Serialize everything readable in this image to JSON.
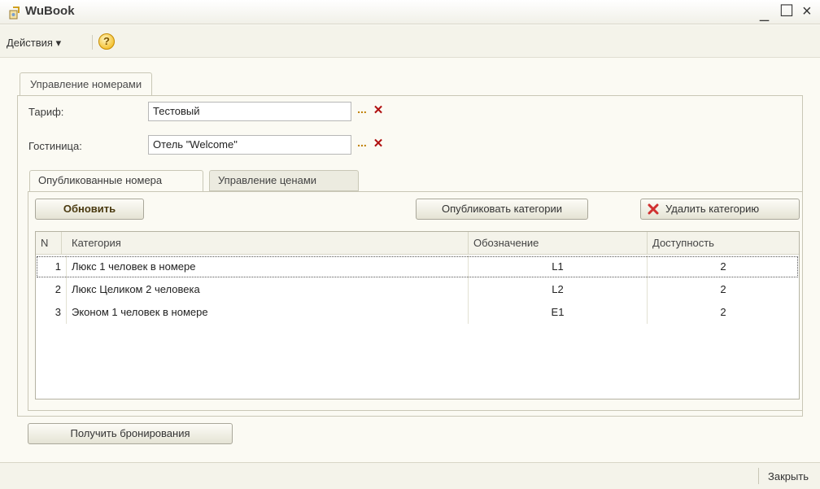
{
  "window": {
    "title": "WuBook"
  },
  "toolbar": {
    "actions_label": "Действия",
    "actions_arrow": "▾",
    "help_symbol": "?"
  },
  "main_tab": {
    "label": "Управление номерами"
  },
  "form": {
    "tariff": {
      "label": "Тариф:",
      "value": "Тестовый"
    },
    "hotel": {
      "label": "Гостиница:",
      "value": "Отель \"Welcome\""
    },
    "pick_symbol": "...",
    "clear_symbol": "✕"
  },
  "subtabs": [
    {
      "label": "Опубликованные номера",
      "active": true
    },
    {
      "label": "Управление ценами",
      "active": false
    }
  ],
  "buttons": {
    "refresh": "Обновить",
    "publish": "Опубликовать категории",
    "delete": "Удалить категорию",
    "get_bookings": "Получить бронирования"
  },
  "table": {
    "columns": [
      "N",
      "Категория",
      "Обозначение",
      "Доступность"
    ],
    "rows": [
      {
        "n": "1",
        "category": "Люкс 1 человек в номере",
        "code": "L1",
        "availability": "2"
      },
      {
        "n": "2",
        "category": "Люкс Целиком 2 человека",
        "code": "L2",
        "availability": "2"
      },
      {
        "n": "3",
        "category": "Эконом 1 человек в номере",
        "code": "E1",
        "availability": "2"
      }
    ]
  },
  "statusbar": {
    "close_label": "Закрыть"
  },
  "colors": {
    "window_bg": "#fbfaf3",
    "border": "#c9c7b6",
    "delete_icon": "#d03030"
  }
}
